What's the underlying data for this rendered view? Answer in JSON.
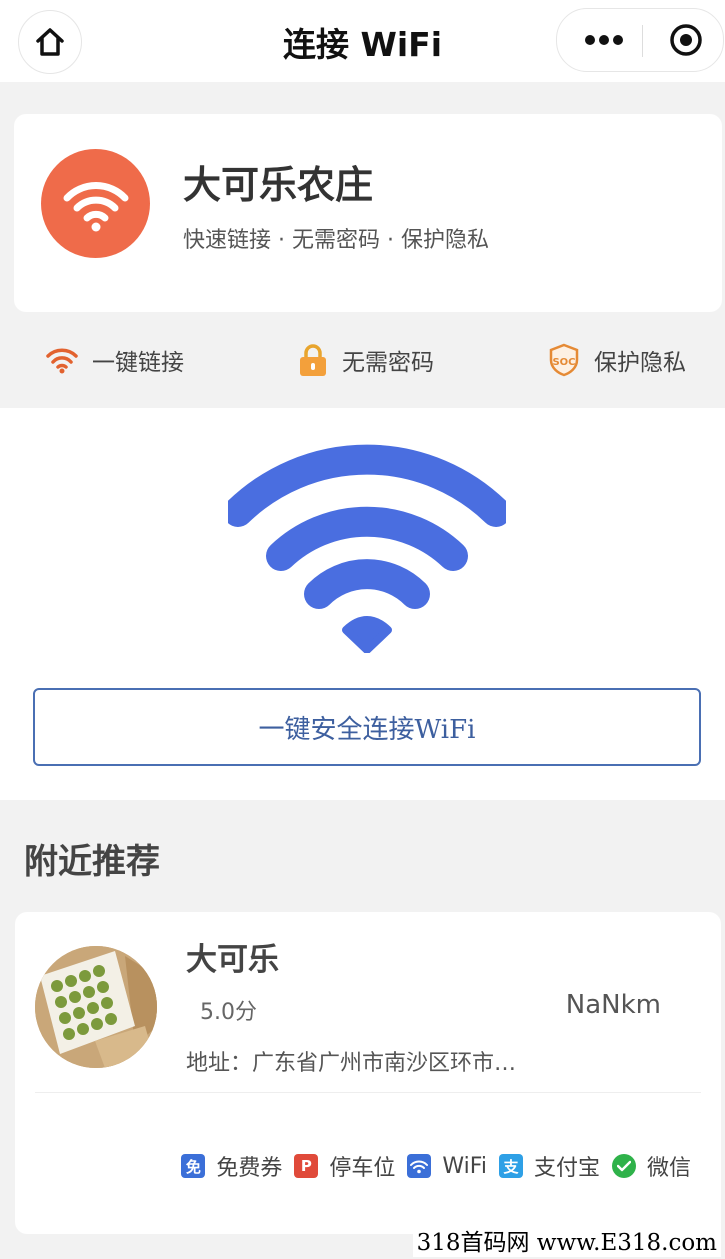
{
  "nav": {
    "title": "连接 WiFi"
  },
  "shop": {
    "name": "大可乐农庄",
    "tagline": "快速链接 · 无需密码 · 保护隐私"
  },
  "features": [
    {
      "label": "一键链接",
      "icon": "wifi-icon",
      "color": "#e2622f"
    },
    {
      "label": "无需密码",
      "icon": "lock-icon",
      "color": "#f0a23a"
    },
    {
      "label": "保护隐私",
      "icon": "soc-shield-icon",
      "color": "#e58a35"
    }
  ],
  "hero": {
    "button_label": "一键安全连接WiFi",
    "wifi_color": "#4a6ee0"
  },
  "nearby": {
    "title": "附近推荐",
    "item": {
      "name": "大可乐",
      "score": "5.0分",
      "distance": "NaNkm",
      "address": "地址：广东省广州市南沙区环市…",
      "tags": [
        {
          "label": "免费券",
          "icon_text": "免",
          "color": "#3b6fd8"
        },
        {
          "label": "停车位",
          "icon_text": "P",
          "color": "#e04a3a"
        },
        {
          "label": "WiFi",
          "icon_text": "",
          "color": "#3b6fd8"
        },
        {
          "label": "支付宝",
          "icon_text": "支",
          "color": "#2ea0e6"
        },
        {
          "label": "微信",
          "icon_text": "",
          "color": "#2fb24a"
        }
      ]
    }
  },
  "watermark": "318首码网 www.E318.com"
}
